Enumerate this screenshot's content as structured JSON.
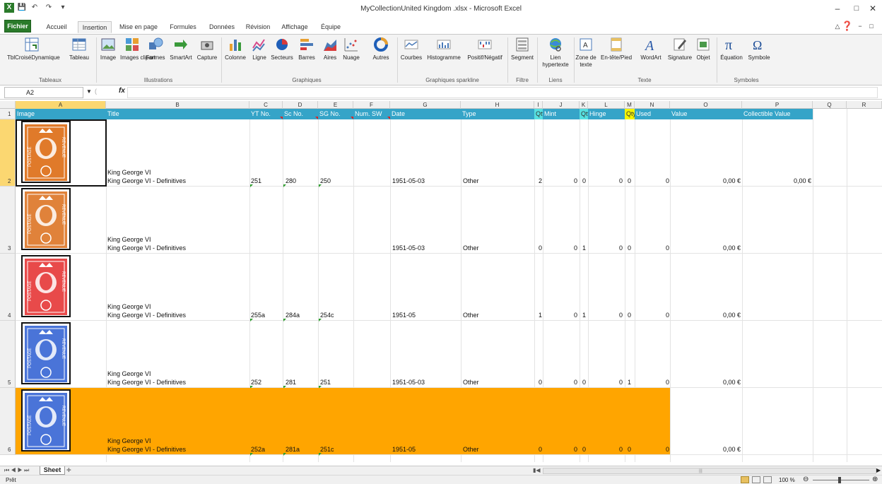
{
  "window": {
    "title": "MyCollectionUnited Kingdom .xlsx - Microsoft Excel"
  },
  "tabs": [
    "Fichier",
    "Accueil",
    "Insertion",
    "Mise en page",
    "Formules",
    "Données",
    "Révision",
    "Affichage",
    "Équipe"
  ],
  "ribbon": {
    "buttons": [
      {
        "label": "TblCroiséDynamique",
        "icon": "pivot-table-icon"
      },
      {
        "label": "Tableau",
        "icon": "table-icon"
      },
      {
        "label": "Image",
        "icon": "image-icon"
      },
      {
        "label": "Images clipart",
        "icon": "clipart-icon"
      },
      {
        "label": "Formes",
        "icon": "shapes-icon"
      },
      {
        "label": "SmartArt",
        "icon": "smartart-icon"
      },
      {
        "label": "Capture",
        "icon": "screenshot-icon"
      },
      {
        "label": "Colonne",
        "icon": "column-chart-icon"
      },
      {
        "label": "Ligne",
        "icon": "line-chart-icon"
      },
      {
        "label": "Secteurs",
        "icon": "pie-chart-icon"
      },
      {
        "label": "Barres",
        "icon": "bar-chart-icon"
      },
      {
        "label": "Aires",
        "icon": "area-chart-icon"
      },
      {
        "label": "Nuage",
        "icon": "scatter-chart-icon"
      },
      {
        "label": "Autres",
        "icon": "other-charts-icon"
      },
      {
        "label": "Courbes",
        "icon": "sparkline-line-icon"
      },
      {
        "label": "Histogramme",
        "icon": "sparkline-column-icon"
      },
      {
        "label": "Positif/Négatif",
        "icon": "sparkline-winloss-icon"
      },
      {
        "label": "Segment",
        "icon": "slicer-icon"
      },
      {
        "label": "Lien hypertexte",
        "icon": "hyperlink-icon"
      },
      {
        "label": "Zone de texte",
        "icon": "textbox-icon"
      },
      {
        "label": "En-tête/Pied",
        "icon": "header-footer-icon"
      },
      {
        "label": "WordArt",
        "icon": "wordart-icon"
      },
      {
        "label": "Signature",
        "icon": "signature-icon"
      },
      {
        "label": "Objet",
        "icon": "object-icon"
      },
      {
        "label": "Équation",
        "icon": "equation-icon"
      },
      {
        "label": "Symbole",
        "icon": "symbol-icon"
      }
    ],
    "groups": [
      "Tableaux",
      "Illustrations",
      "Graphiques",
      "Graphiques sparkline",
      "Filtre",
      "Liens",
      "Texte",
      "Symboles"
    ]
  },
  "formula_bar": {
    "name_box": "A2",
    "fx": "fx",
    "value": ""
  },
  "columns": [
    "A",
    "B",
    "C",
    "D",
    "E",
    "F",
    "G",
    "H",
    "I",
    "J",
    "K",
    "L",
    "M",
    "N",
    "O",
    "P",
    "Q",
    "R"
  ],
  "header_row": {
    "row_num": "1",
    "cells": [
      "Image",
      "Title",
      "YT No.",
      "Sc No.",
      "SG No.",
      "Num. SW",
      "Date",
      "Type",
      "Qty",
      "Mint",
      "Qty",
      "Hinge",
      "Qty",
      "Used",
      "Value",
      "Collectible Value"
    ]
  },
  "rows": [
    {
      "num": "2",
      "title1": "King George VI",
      "title2": "King George VI - Definitives",
      "yt": "251",
      "sc": "280",
      "sg": "250",
      "sw": "",
      "date": "1951-05-03",
      "type": "Other",
      "q1": "2",
      "mint": "0",
      "q2": "0",
      "hinge": "0",
      "q3": "0",
      "used": "0",
      "value": "0,00 €",
      "cvalue": "0,00 €",
      "stamp_color": "#e07a2a",
      "highlight": false
    },
    {
      "num": "3",
      "title1": "King George VI",
      "title2": "King George VI - Definitives",
      "yt": "",
      "sc": "",
      "sg": "",
      "sw": "",
      "date": "1951-05-03",
      "type": "Other",
      "q1": "0",
      "mint": "0",
      "q2": "1",
      "hinge": "0",
      "q3": "0",
      "used": "0",
      "value": "0,00 €",
      "cvalue": "",
      "stamp_color": "#e0823a",
      "highlight": false
    },
    {
      "num": "4",
      "title1": "King George VI",
      "title2": "King George VI - Definitives",
      "yt": "255a",
      "sc": "284a",
      "sg": "254c",
      "sw": "",
      "date": "1951-05",
      "type": "Other",
      "q1": "1",
      "mint": "0",
      "q2": "1",
      "hinge": "0",
      "q3": "0",
      "used": "0",
      "value": "0,00 €",
      "cvalue": "",
      "stamp_color": "#e84a4a",
      "highlight": false
    },
    {
      "num": "5",
      "title1": "King George VI",
      "title2": "King George VI - Definitives",
      "yt": "252",
      "sc": "281",
      "sg": "251",
      "sw": "",
      "date": "1951-05-03",
      "type": "Other",
      "q1": "0",
      "mint": "0",
      "q2": "0",
      "hinge": "0",
      "q3": "1",
      "used": "0",
      "value": "0,00 €",
      "cvalue": "",
      "stamp_color": "#4a74d8",
      "highlight": false
    },
    {
      "num": "6",
      "title1": "King George VI",
      "title2": "King George VI - Definitives",
      "yt": "252a",
      "sc": "281a",
      "sg": "251c",
      "sw": "",
      "date": "1951-05",
      "type": "Other",
      "q1": "0",
      "mint": "0",
      "q2": "0",
      "hinge": "0",
      "q3": "0",
      "used": "0",
      "value": "0,00 €",
      "cvalue": "",
      "stamp_color": "#4a74d8",
      "highlight": true
    }
  ],
  "stamp_text": {
    "postage": "POSTAGE",
    "revenue": "REVENUE"
  },
  "sheet_tabs": {
    "active": "Sheet"
  },
  "status": {
    "ready": "Prêt",
    "zoom": "100 %"
  },
  "colors": {
    "header_bg": "#35a4c8",
    "highlight_row": "#ffa500",
    "qty_cyan": "#56e0e0",
    "qty_yellow": "#f4f400",
    "file_tab": "#2a7a2a"
  }
}
